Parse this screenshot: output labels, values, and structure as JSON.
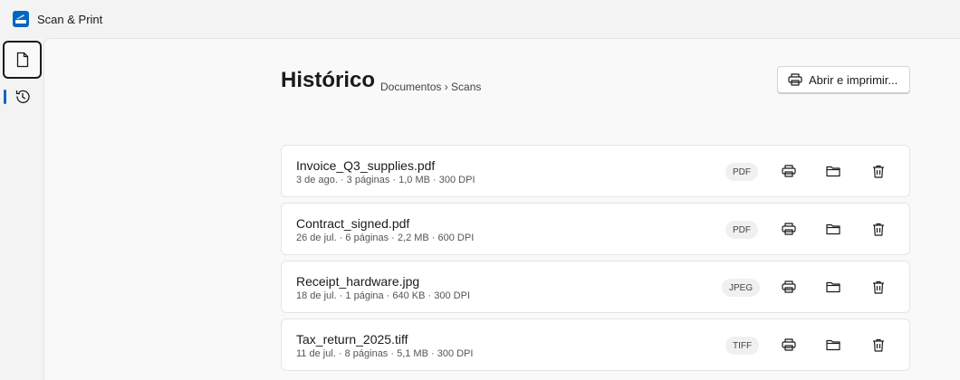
{
  "app": {
    "title": "Scan & Print",
    "accent": "#0067c0"
  },
  "sidebar": {
    "items": [
      {
        "icon": "document-icon",
        "selected": true
      },
      {
        "icon": "history-icon",
        "selected": false
      }
    ]
  },
  "header": {
    "title": "Histórico",
    "breadcrumb": "Documentos › Scans",
    "open_print_label": "Abrir e imprimir..."
  },
  "files": [
    {
      "name": "Invoice_Q3_supplies.pdf",
      "meta": "3 de ago. · 3 páginas · 1,0 MB · 300 DPI",
      "type": "PDF"
    },
    {
      "name": "Contract_signed.pdf",
      "meta": "26 de jul. · 6 páginas · 2,2 MB · 600 DPI",
      "type": "PDF"
    },
    {
      "name": "Receipt_hardware.jpg",
      "meta": "18 de jul. · 1 página · 640 KB · 300 DPI",
      "type": "JPEG"
    },
    {
      "name": "Tax_return_2025.tiff",
      "meta": "11 de jul. · 8 páginas · 5,1 MB · 300 DPI",
      "type": "TIFF"
    }
  ]
}
